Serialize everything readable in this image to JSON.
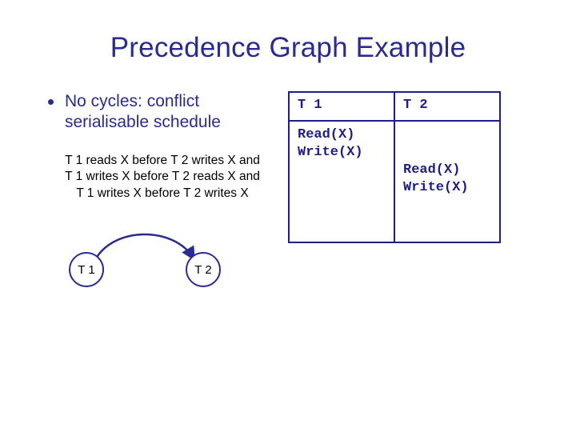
{
  "title": "Precedence Graph Example",
  "bullet": "No cycles: conflict serialisable schedule",
  "conflicts": {
    "line1": "T 1 reads X before T 2 writes X and",
    "line2": "T 1 writes X before T 2 reads X and",
    "line3": "T 1 writes X before T 2 writes X"
  },
  "graph": {
    "node1": "T 1",
    "node2": "T 2"
  },
  "schedule": {
    "h1": "T 1",
    "h2": "T 2",
    "t1": {
      "op1": "Read(X)",
      "op2": "Write(X)"
    },
    "t2": {
      "op1": "Read(X)",
      "op2": "Write(X)"
    }
  },
  "chart_data": {
    "type": "table",
    "title": "Precedence Graph Example",
    "schedule": {
      "columns": [
        "T1",
        "T2"
      ],
      "rows": [
        [
          "Read(X)",
          ""
        ],
        [
          "Write(X)",
          ""
        ],
        [
          "",
          "Read(X)"
        ],
        [
          "",
          "Write(X)"
        ]
      ]
    },
    "conflict_edges": [
      {
        "from": "T1",
        "to": "T2",
        "reason": "T1 reads X before T2 writes X"
      },
      {
        "from": "T1",
        "to": "T2",
        "reason": "T1 writes X before T2 reads X"
      },
      {
        "from": "T1",
        "to": "T2",
        "reason": "T1 writes X before T2 writes X"
      }
    ],
    "precedence_graph": {
      "nodes": [
        "T1",
        "T2"
      ],
      "edges": [
        [
          "T1",
          "T2"
        ]
      ],
      "has_cycle": false
    },
    "conclusion": "No cycles: conflict serialisable schedule"
  }
}
